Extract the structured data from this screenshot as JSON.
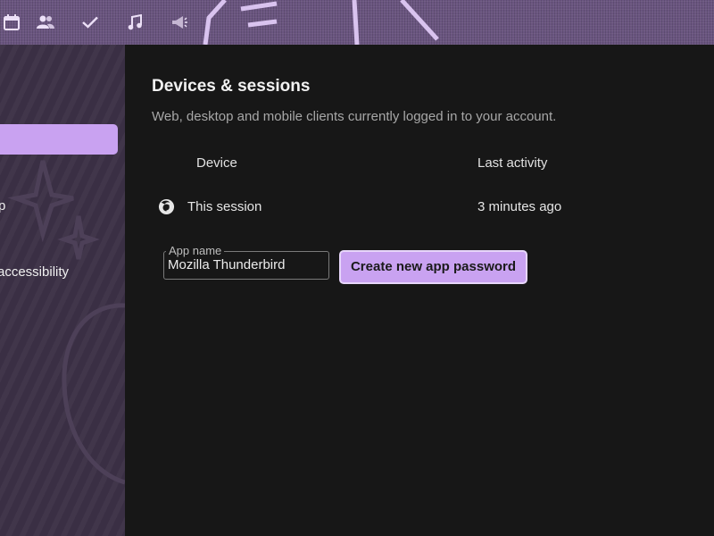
{
  "topbar": {
    "icons": [
      "calendar-icon",
      "people-icon",
      "checkmark-icon",
      "music-note-icon",
      "megaphone-icon"
    ]
  },
  "sidebar": {
    "items": [
      {
        "label": "",
        "active": true
      },
      {
        "label": "p"
      },
      {
        "label": " accessibility"
      }
    ]
  },
  "main": {
    "title": "Devices & sessions",
    "subtitle": "Web, desktop and mobile clients currently logged in to your account.",
    "columns": [
      "Device",
      "Last activity"
    ],
    "sessions": [
      {
        "icon": "firefox-icon",
        "device": "This session",
        "last_activity": "3 minutes ago"
      }
    ],
    "app_password": {
      "field_label": "App name",
      "field_value": "Mozilla Thunderbird",
      "button_label": "Create new app password"
    }
  },
  "colors": {
    "accent": "#c9a2f1",
    "background": "#171717",
    "sidebar": "#3a2f44",
    "header": "#6a5580"
  }
}
